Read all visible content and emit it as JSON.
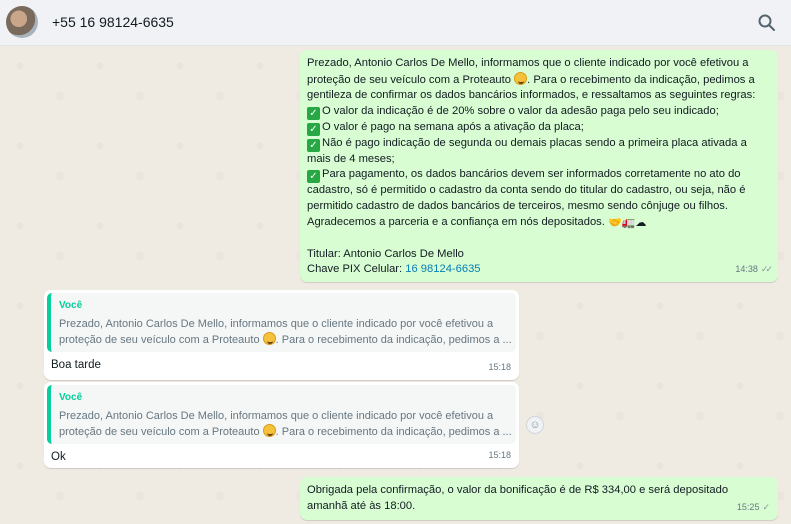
{
  "header": {
    "contact_name": "+55 16 98124-6635",
    "search_icon": "search-icon"
  },
  "messages": {
    "m1": {
      "lines": [
        "Prezado, Antonio Carlos De Mello, informamos que o cliente indicado por você efetivou a",
        "proteção de seu veículo com a Proteauto",
        ". Para o recebimento da indicação, pedimos a",
        "gentileza de confirmar os dados bancários informados, e  ressaltamos as seguintes regras:",
        "O valor da indicação é de 20% sobre o valor da adesão paga pelo seu indicado;",
        "O valor é pago na semana após a ativação da placa;",
        "Não é pago indicação de segunda ou demais placas sendo a primeira placa ativada a",
        "mais de 4 meses;",
        "Para pagamento, os dados bancários devem ser informados corretamente no ato do",
        "cadastro, só é permitido o cadastro da conta sendo do titular do cadastro, ou seja, não é",
        "permitido cadastro de dados bancários de terceiros, mesmo sendo cônjuge ou filhos.",
        "Agradecemos a parceria e a confiança em nós depositados.",
        "Titular: Antonio Carlos De Mello",
        "Chave PIX Celular: ",
        "16 98124-6635"
      ],
      "time": "14:38"
    },
    "m2": {
      "quote_author": "Você",
      "quote_line1": "Prezado, Antonio Carlos De Mello, informamos que o cliente indicado por você efetivou a",
      "quote_line2a": "proteção de seu veículo com a Proteauto",
      "quote_line2b": ". Para o recebimento da indicação, pedimos a ...",
      "text": "Boa tarde",
      "time": "15:18"
    },
    "m3": {
      "quote_author": "Você",
      "quote_line1": "Prezado, Antonio Carlos De Mello, informamos que o cliente indicado por você efetivou a",
      "quote_line2a": "proteção de seu veículo com a Proteauto",
      "quote_line2b": ". Para o recebimento da indicação, pedimos a ...",
      "text": "Ok",
      "time": "15:18"
    },
    "m4": {
      "line1": "Obrigada pela confirmação, o valor da bonificação é de R$ 334,00 e será depositado",
      "line2": "amanhã até às 18:00.",
      "time": "15:25"
    }
  },
  "colors": {
    "outgoing_bubble": "#d9fdd3",
    "incoming_bubble": "#ffffff",
    "quote_accent": "#06cf9c",
    "link": "#027eb5",
    "read_ticks": "#53bdeb"
  }
}
